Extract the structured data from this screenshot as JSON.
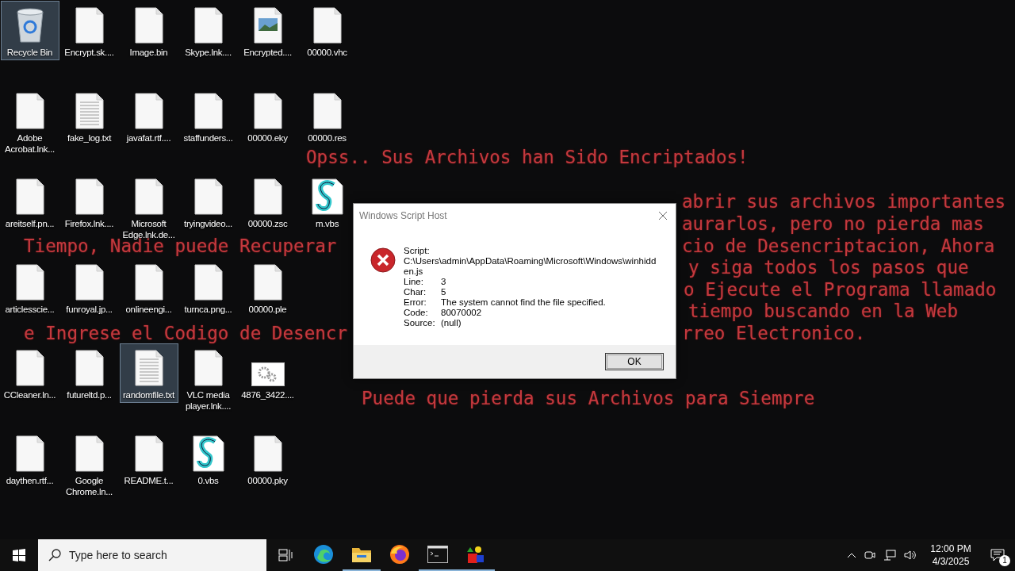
{
  "desktop_icon_rows": [
    [
      {
        "label": "Recycle Bin",
        "kind": "recycle",
        "selected": true
      },
      {
        "label": "Encrypt.sk....",
        "kind": "blank",
        "selected": false
      },
      {
        "label": "Image.bin",
        "kind": "blank",
        "selected": false
      },
      {
        "label": "Skype.lnk....",
        "kind": "blank",
        "selected": false
      },
      {
        "label": "Encrypted....",
        "kind": "image",
        "selected": false
      },
      {
        "label": "00000.vhc",
        "kind": "blank",
        "selected": false
      }
    ],
    [
      {
        "label": "Adobe Acrobat.lnk...",
        "kind": "blank",
        "selected": false
      },
      {
        "label": "fake_log.txt",
        "kind": "text",
        "selected": false
      },
      {
        "label": "javafat.rtf....",
        "kind": "blank",
        "selected": false
      },
      {
        "label": "staffunders...",
        "kind": "blank",
        "selected": false
      },
      {
        "label": "00000.eky",
        "kind": "blank",
        "selected": false
      },
      {
        "label": "00000.res",
        "kind": "blank",
        "selected": false
      }
    ],
    [
      {
        "label": "areitself.pn...",
        "kind": "blank",
        "selected": false
      },
      {
        "label": "Firefox.lnk....",
        "kind": "blank",
        "selected": false
      },
      {
        "label": "Microsoft Edge.lnk.de...",
        "kind": "blank",
        "selected": false
      },
      {
        "label": "tryingvideo...",
        "kind": "blank",
        "selected": false
      },
      {
        "label": "00000.zsc",
        "kind": "blank",
        "selected": false
      },
      {
        "label": "m.vbs",
        "kind": "script",
        "selected": false
      }
    ],
    [
      {
        "label": "articlesscie...",
        "kind": "blank",
        "selected": false
      },
      {
        "label": "funroyal.jp...",
        "kind": "blank",
        "selected": false
      },
      {
        "label": "onlineengi...",
        "kind": "blank",
        "selected": false
      },
      {
        "label": "turnca.png...",
        "kind": "blank",
        "selected": false
      },
      {
        "label": "00000.ple",
        "kind": "blank",
        "selected": false
      }
    ],
    [
      {
        "label": "CCleaner.ln...",
        "kind": "blank",
        "selected": false
      },
      {
        "label": "futureltd.p...",
        "kind": "blank",
        "selected": false
      },
      {
        "label": "randomfile.txt",
        "kind": "text",
        "selected": true
      },
      {
        "label": "VLC media player.lnk....",
        "kind": "blank",
        "selected": false
      },
      {
        "label": "4876_3422....",
        "kind": "settings",
        "selected": false
      }
    ],
    [
      {
        "label": "daythen.rtf...",
        "kind": "blank",
        "selected": false
      },
      {
        "label": "Google Chrome.ln...",
        "kind": "blank",
        "selected": false
      },
      {
        "label": "README.t...",
        "kind": "blank",
        "selected": false
      },
      {
        "label": "0.vbs",
        "kind": "script",
        "selected": false
      },
      {
        "label": "00000.pky",
        "kind": "blank",
        "selected": false
      }
    ]
  ],
  "ransom_note": [
    "Opss.. Sus Archivos han Sido Encriptados!",
    "abrir sus archivos importantes",
    "aurarlos, pero no pierda mas",
    "Tiempo, Nadie puede Recuperar",
    "cio de Desencriptacion, Ahora",
    "y siga todos los pasos que",
    "o Ejecute el Programa llamado",
    "tiempo buscando en la Web",
    "e Ingrese el Codigo de Desencr",
    "rreo Electronico.",
    "Puede que pierda sus Archivos para Siempre"
  ],
  "dialog": {
    "title": "Windows Script Host",
    "fields": [
      {
        "label": "Script:",
        "value": "C:\\Users\\admin\\AppData\\Roaming\\Microsoft\\Windows\\winhidden.js",
        "kind": "block"
      },
      {
        "label": "Line:",
        "value": "3",
        "kind": "inline"
      },
      {
        "label": "Char:",
        "value": "5",
        "kind": "inline"
      },
      {
        "label": "Error:",
        "value": "The system cannot find the file specified.",
        "kind": "inline"
      },
      {
        "label": "Code:",
        "value": "80070002",
        "kind": "inline"
      },
      {
        "label": "Source:",
        "value": "(null)",
        "kind": "inline"
      }
    ],
    "button": "OK"
  },
  "taskbar": {
    "search": {
      "placeholder": "Type here to search"
    },
    "apps": [
      {
        "kind": "edge",
        "running": false
      },
      {
        "kind": "folder",
        "running": true
      },
      {
        "kind": "firefox",
        "running": false
      },
      {
        "kind": "terminal",
        "running": true
      },
      {
        "kind": "shapes",
        "running": true
      }
    ],
    "time": "12:00 PM",
    "date": "4/3/2025",
    "notifications": "1"
  }
}
